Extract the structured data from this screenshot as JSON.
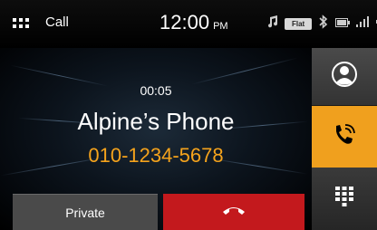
{
  "status_bar": {
    "app_title": "Call",
    "time": "12:00",
    "ampm": "PM",
    "eq_badge": "Flat",
    "icons": [
      "menu-grid-icon",
      "music-note-icon",
      "bluetooth-icon",
      "battery-icon",
      "signal-icon",
      "volume-icon"
    ]
  },
  "call": {
    "duration": "00:05",
    "caller_name": "Alpine’s Phone",
    "caller_number": "010-1234-5678"
  },
  "buttons": {
    "private_label": "Private",
    "end_call_icon": "hang-up-icon"
  },
  "side_menu": [
    {
      "name": "contacts",
      "icon": "contacts-icon"
    },
    {
      "name": "active-call",
      "icon": "phone-ringing-icon",
      "active": true
    },
    {
      "name": "keypad",
      "icon": "keypad-icon"
    }
  ],
  "colors": {
    "accent": "#f0a01e",
    "end_call": "#c3191d",
    "number_text": "#f5a31c",
    "private_button": "#4a4a4a"
  }
}
